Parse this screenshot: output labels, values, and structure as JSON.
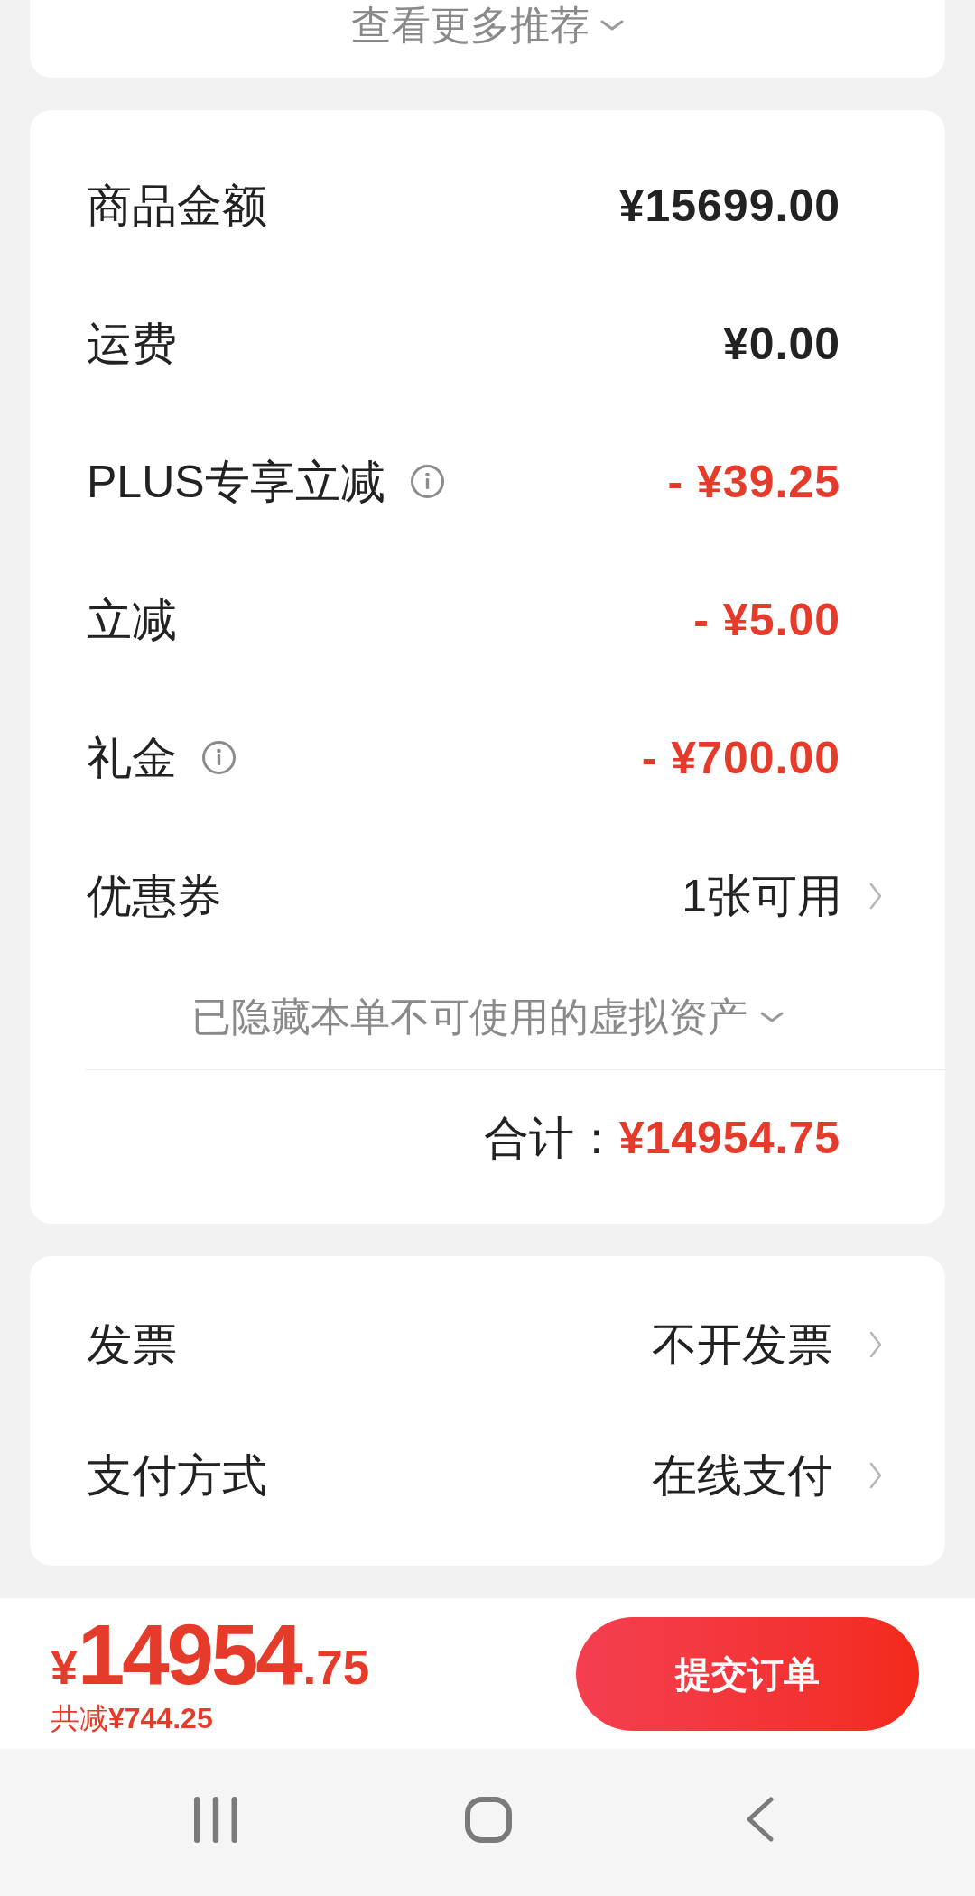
{
  "recommendations": {
    "label": "查看更多推荐"
  },
  "price_summary": {
    "rows": [
      {
        "kind": "amount",
        "label": "商品金额",
        "value": "¥15699.00",
        "info_icon": false
      },
      {
        "kind": "amount",
        "label": "运费",
        "value": "¥0.00",
        "info_icon": false
      },
      {
        "kind": "discount",
        "label": "PLUS专享立减",
        "value": "- ¥39.25",
        "info_icon": true
      },
      {
        "kind": "discount",
        "label": "立减",
        "value": "- ¥5.00",
        "info_icon": false
      },
      {
        "kind": "discount",
        "label": "礼金",
        "value": "- ¥700.00",
        "info_icon": true
      },
      {
        "kind": "link",
        "label": "优惠券",
        "value": "1张可用",
        "info_icon": false
      }
    ],
    "hidden_assets_note": "已隐藏本单不可使用的虚拟资产",
    "total": {
      "label": "合计：",
      "value": "¥14954.75"
    }
  },
  "order_options": {
    "rows": [
      {
        "label": "发票",
        "value": "不开发票"
      },
      {
        "label": "支付方式",
        "value": "在线支付"
      }
    ]
  },
  "checkout_bar": {
    "price": {
      "currency": "¥",
      "integer": "14954",
      "decimal": ".75"
    },
    "savings": "共减**¥744.25**",
    "submit_button": "提交订单"
  }
}
